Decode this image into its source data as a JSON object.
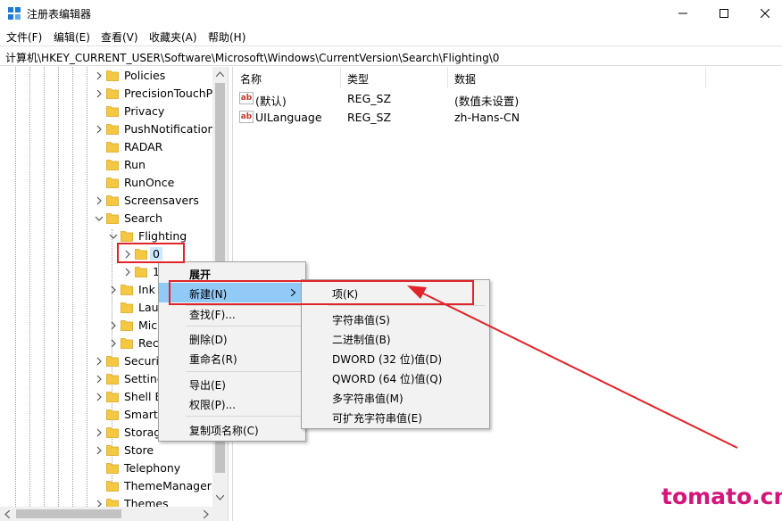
{
  "window": {
    "title": "注册表编辑器",
    "icon": "regedit-icon",
    "controls": [
      "minimize-icon",
      "maximize-icon",
      "close-icon"
    ]
  },
  "menu": [
    "文件(F)",
    "编辑(E)",
    "查看(V)",
    "收藏夹(A)",
    "帮助(H)"
  ],
  "address": "计算机\\HKEY_CURRENT_USER\\Software\\Microsoft\\Windows\\CurrentVersion\\Search\\Flighting\\0",
  "tree": {
    "items": [
      {
        "label": "Policies",
        "expander": "collapsed"
      },
      {
        "label": "PrecisionTouchPa",
        "expander": "collapsed"
      },
      {
        "label": "Privacy",
        "expander": "none"
      },
      {
        "label": "PushNotifications",
        "expander": "collapsed"
      },
      {
        "label": "RADAR",
        "expander": "none"
      },
      {
        "label": "Run",
        "expander": "none"
      },
      {
        "label": "RunOnce",
        "expander": "none"
      },
      {
        "label": "Screensavers",
        "expander": "collapsed"
      },
      {
        "label": "Search",
        "expander": "expanded"
      },
      {
        "label": "Flighting",
        "expander": "expanded"
      },
      {
        "label": "0",
        "expander": "collapsed",
        "selected": true
      },
      {
        "label": "1",
        "expander": "collapsed"
      },
      {
        "label": "Ink",
        "expander": "collapsed"
      },
      {
        "label": "Lau",
        "expander": "none"
      },
      {
        "label": "Mic",
        "expander": "collapsed"
      },
      {
        "label": "Rec",
        "expander": "collapsed"
      },
      {
        "label": "Securit",
        "expander": "collapsed"
      },
      {
        "label": "Setting",
        "expander": "collapsed"
      },
      {
        "label": "Shell E",
        "expander": "collapsed"
      },
      {
        "label": "SmartG",
        "expander": "none"
      },
      {
        "label": "Storag",
        "expander": "collapsed"
      },
      {
        "label": "Store",
        "expander": "collapsed"
      },
      {
        "label": "Telephony",
        "expander": "none"
      },
      {
        "label": "ThemeManager",
        "expander": "none"
      },
      {
        "label": "Themes",
        "expander": "collapsed"
      }
    ]
  },
  "list": {
    "columns": [
      "名称",
      "类型",
      "数据"
    ],
    "rows": [
      {
        "name": "(默认)",
        "type": "REG_SZ",
        "data": "(数值未设置)"
      },
      {
        "name": "UILanguage",
        "type": "REG_SZ",
        "data": "zh-Hans-CN"
      }
    ]
  },
  "context_menu": {
    "items": [
      "展开",
      "新建(N)",
      "查找(F)...",
      "删除(D)",
      "重命名(R)",
      "导出(E)",
      "权限(P)...",
      "复制项名称(C)"
    ],
    "highlighted": "新建(N)"
  },
  "submenu": {
    "items": [
      "项(K)",
      "字符串值(S)",
      "二进制值(B)",
      "DWORD (32 位)值(D)",
      "QWORD (64 位)值(Q)",
      "多字符串值(M)",
      "可扩充字符串值(E)"
    ]
  },
  "watermark": "tomato.cm",
  "colors": {
    "menu_highlight": "#91c9f7",
    "annotation_red": "#e0242a",
    "watermark": "#d4157a",
    "folder": "#f5c842"
  }
}
